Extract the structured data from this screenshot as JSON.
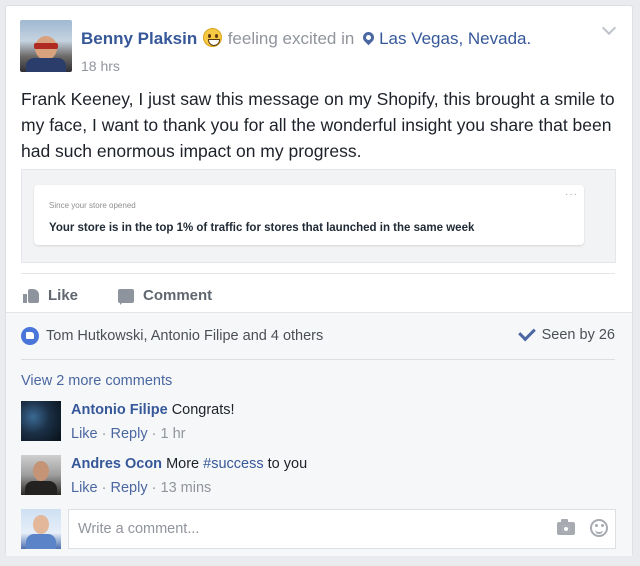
{
  "post": {
    "author": "Benny Plaksin",
    "feeling_text": "feeling excited in",
    "location": "Las Vegas, Nevada.",
    "timestamp": "18 hrs",
    "body": "Frank Keeney, I just saw this message on my Shopify, this brought a smile to my face, I want to thank you for all the wonderful insight you share that been had such enormous impact on my progress.",
    "embed": {
      "small_text": "Since your store opened",
      "headline": "Your store is in the top 1% of traffic for stores that launched in the same week",
      "menu_glyph": "···"
    }
  },
  "actions": {
    "like_label": "Like",
    "comment_label": "Comment"
  },
  "reactions": {
    "names": "Tom Hutkowski, Antonio Filipe and 4 others",
    "seen": "Seen by 26"
  },
  "comments": {
    "view_more": "View 2 more comments",
    "items": [
      {
        "name": "Antonio Filipe",
        "text": "Congrats!",
        "like": "Like",
        "reply": "Reply",
        "time": "1 hr"
      },
      {
        "name": "Andres Ocon",
        "text_before": "More",
        "hashtag": "#success",
        "text_after": "to you",
        "like": "Like",
        "reply": "Reply",
        "time": "13 mins"
      }
    ],
    "separator": "·"
  },
  "composer": {
    "placeholder": "Write a comment..."
  },
  "colors": {
    "link_blue": "#365899",
    "muted_gray": "#90949c",
    "like_blue": "#4a76d9"
  }
}
